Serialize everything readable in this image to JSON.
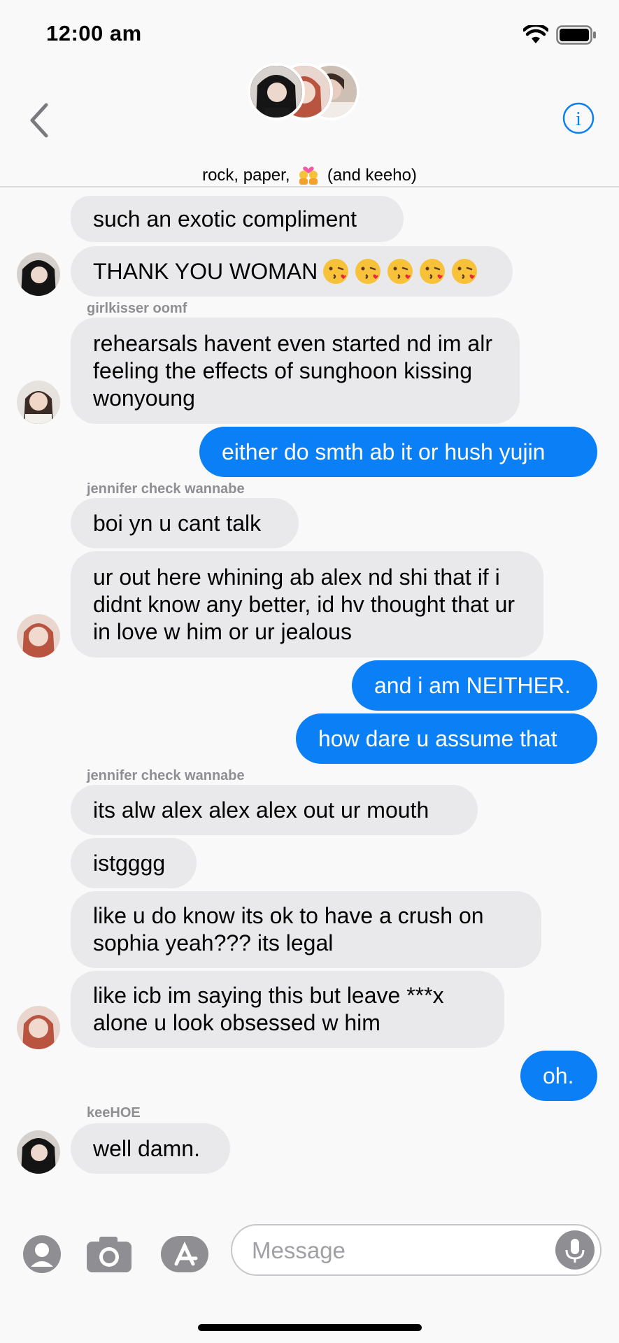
{
  "status_bar": {
    "time": "12:00 am"
  },
  "header": {
    "group_name_before": "rock, paper,",
    "group_name_after": "(and keeho)"
  },
  "messages": [
    {
      "text": "such an exotic compliment"
    },
    {
      "text": "THANK YOU WOMAN"
    },
    {
      "sender": "girlkisser oomf",
      "text": "rehearsals havent even started nd im alr feeling the effects of sunghoon kissing wonyoung"
    },
    {
      "text": "either do smth ab it or hush yujin"
    },
    {
      "sender": "jennifer check wannabe",
      "text": "boi yn u cant talk"
    },
    {
      "text": "ur out here whining ab alex nd shi that if i didnt know any better, id hv thought that ur in love w him or ur jealous"
    },
    {
      "text": "and i am NEITHER."
    },
    {
      "text": "how dare u assume that"
    },
    {
      "sender": "jennifer check wannabe",
      "text": "its alw alex alex alex out ur mouth"
    },
    {
      "text": "istgggg"
    },
    {
      "text": "like u do know its ok to have a crush on sophia yeah??? its legal"
    },
    {
      "text": "like icb im saying this but leave ***x alone u look obsessed w him"
    },
    {
      "text": "oh."
    },
    {
      "sender": "keeHOE",
      "text": "well damn."
    }
  ],
  "composer": {
    "placeholder": "Message"
  },
  "colors": {
    "outgoing": "#0b7ff5",
    "incoming": "#e9e9eb",
    "accent": "#0b7ff5"
  }
}
